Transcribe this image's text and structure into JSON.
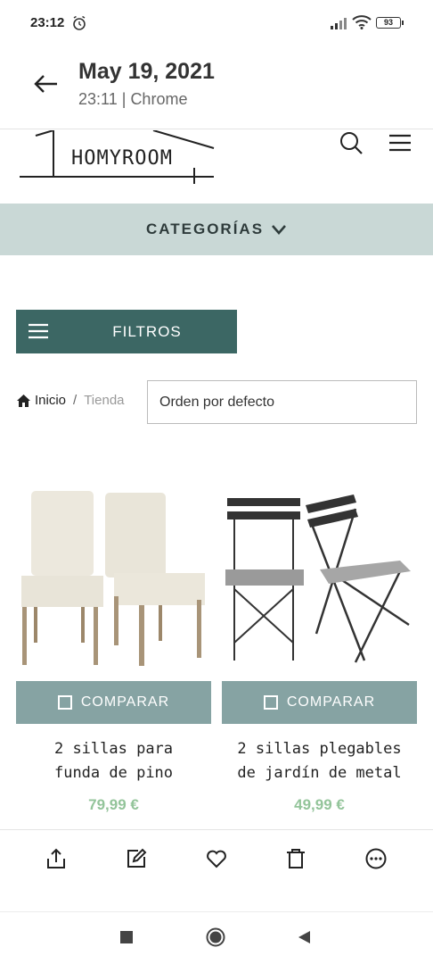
{
  "status_bar": {
    "time": "23:12",
    "battery": "93"
  },
  "header": {
    "title": "May 19, 2021",
    "subtitle_time": "23:11",
    "subtitle_sep": "|",
    "subtitle_app": "Chrome"
  },
  "site": {
    "logo_text": "HOMYROOM",
    "categories_label": "CATEGORÍAS",
    "filter_label": "FILTROS",
    "breadcrumb": {
      "home": "Inicio",
      "separator": "/",
      "current": "Tienda"
    },
    "order_select": "Orden por defecto"
  },
  "products": [
    {
      "compare_label": "COMPARAR",
      "name_line1": "2 sillas para",
      "name_line2": "funda de pino",
      "price": "79,99 €"
    },
    {
      "compare_label": "COMPARAR",
      "name_line1": "2 sillas plegables",
      "name_line2": "de jardín de metal",
      "price": "49,99 €"
    }
  ],
  "colors": {
    "category_bar": "#c9d8d6",
    "filter_button": "#3c6764",
    "compare_button": "#86a3a3",
    "price": "#93c49a"
  },
  "icons": [
    "alarm-icon",
    "signal-icon",
    "wifi-icon",
    "back-icon",
    "search-icon",
    "menu-icon",
    "chevron-down-icon",
    "home-icon",
    "share-icon",
    "edit-icon",
    "heart-icon",
    "trash-icon",
    "more-icon",
    "recents-icon",
    "home-nav-icon",
    "back-nav-icon"
  ]
}
